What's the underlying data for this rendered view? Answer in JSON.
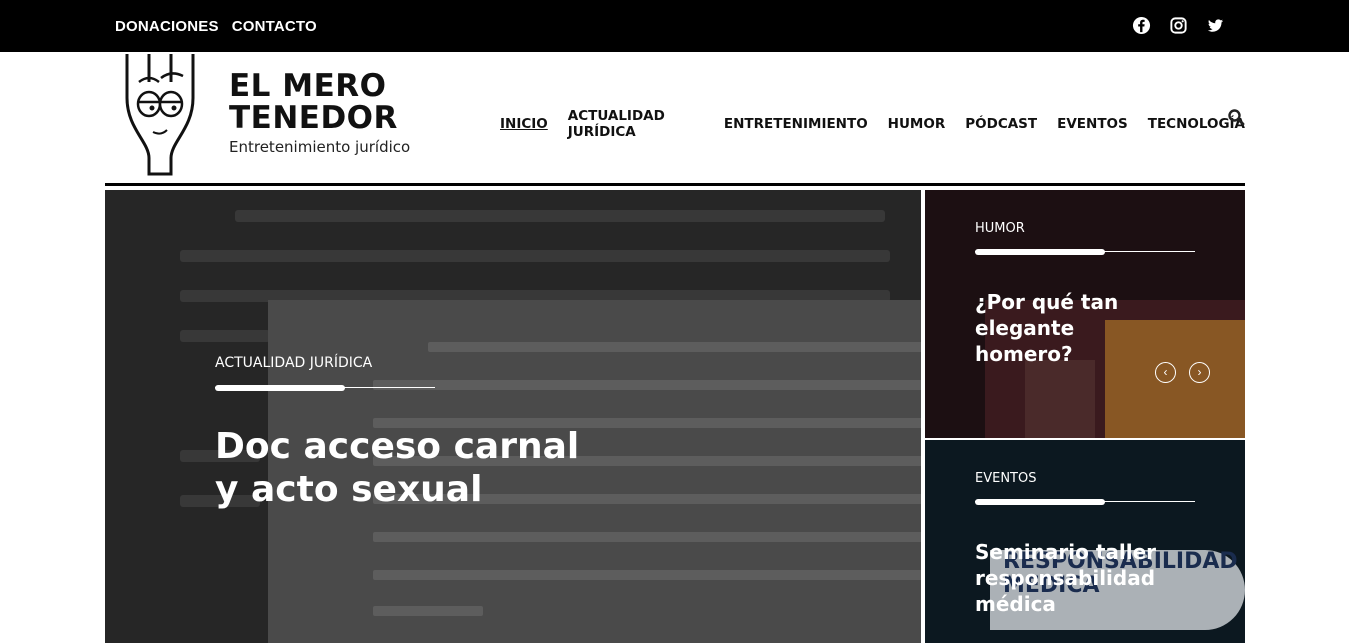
{
  "topbar": {
    "links": [
      "DONACIONES",
      "CONTACTO"
    ],
    "social_icons": [
      "facebook-icon",
      "instagram-icon",
      "twitter-icon"
    ]
  },
  "brand": {
    "title": "EL MERO\nTENEDOR",
    "subtitle": "Entretenimiento jurídico"
  },
  "nav": {
    "items": [
      "INICIO",
      "ACTUALIDAD JURÍDICA",
      "ENTRETENIMIENTO",
      "HUMOR",
      "PÓDCAST",
      "EVENTOS",
      "TECNOLOGÍA"
    ],
    "search_icon": "search-icon"
  },
  "hero": {
    "category": "ACTUALIDAD JURÍDICA",
    "title": "Doc acceso carnal y acto sexual"
  },
  "cards": [
    {
      "category": "HUMOR",
      "title": "¿Por qué tan elegante homero?"
    },
    {
      "category": "EVENTOS",
      "title": "Seminario taller responsabilidad médica",
      "image_text": "RESPONSABILIDAD MEDICA"
    }
  ],
  "colors": {
    "topbar_bg": "#000000",
    "text_dark": "#111111"
  }
}
